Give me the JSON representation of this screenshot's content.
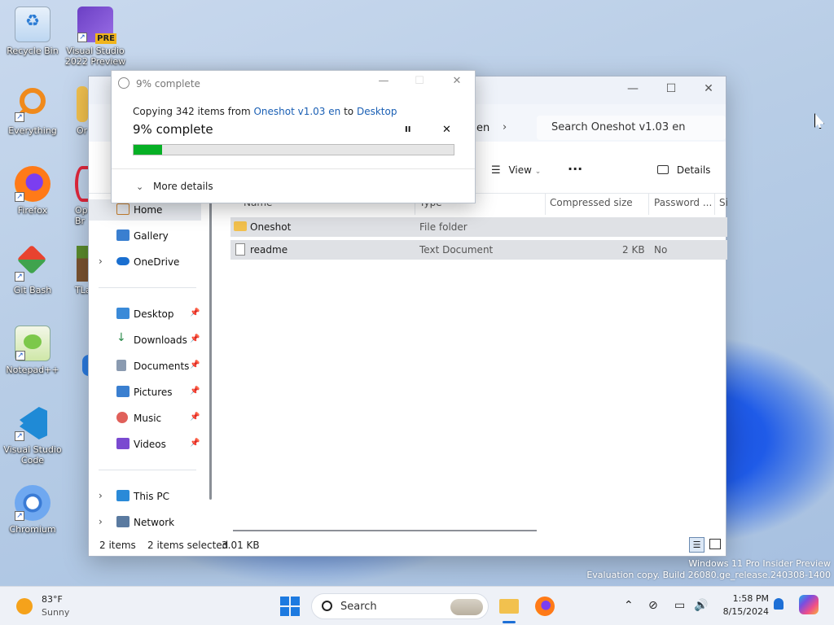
{
  "desktop": {
    "icons": [
      {
        "label": "Recycle Bin"
      },
      {
        "label": "Visual Studio 2022 Preview",
        "badge": "PRE"
      },
      {
        "label": "Everything"
      },
      {
        "label": "Or"
      },
      {
        "label": "Firefox"
      },
      {
        "label": "Op Br"
      },
      {
        "label": "Git Bash"
      },
      {
        "label": "TLa"
      },
      {
        "label": "Notepad++"
      },
      {
        "label": "Visual Studio Code"
      },
      {
        "label": "Chromium"
      }
    ],
    "watermark_line1": "Windows 11 Pro Insider Preview",
    "watermark_line2": "Evaluation copy. Build 26080.ge_release.240308-1400"
  },
  "explorer": {
    "address_crumb": "en",
    "search_placeholder": "Search Oneshot v1.03 en",
    "toolbar": {
      "view_label": "View",
      "more_label": "···",
      "details_label": "Details"
    },
    "sidebar": {
      "items": [
        {
          "label": "Home",
          "selected": true
        },
        {
          "label": "Gallery"
        },
        {
          "label": "OneDrive",
          "expandable": true
        },
        {
          "label": "Desktop",
          "pinned": true
        },
        {
          "label": "Downloads",
          "pinned": true
        },
        {
          "label": "Documents",
          "pinned": true
        },
        {
          "label": "Pictures",
          "pinned": true
        },
        {
          "label": "Music",
          "pinned": true
        },
        {
          "label": "Videos",
          "pinned": true
        },
        {
          "label": "This PC",
          "expandable": true
        },
        {
          "label": "Network",
          "expandable": true
        }
      ]
    },
    "columns": [
      "Name",
      "Type",
      "Compressed size",
      "Password ...",
      "Si"
    ],
    "rows": [
      {
        "name": "Oneshot",
        "type": "File folder",
        "compressed_size": "",
        "password": ""
      },
      {
        "name": "readme",
        "type": "Text Document",
        "compressed_size": "2 KB",
        "password": "No"
      }
    ],
    "status": {
      "items_count": "2 items",
      "selected": "2 items selected",
      "size": "3.01 KB"
    }
  },
  "copy_dialog": {
    "title": "9% complete",
    "copying_prefix": "Copying 342 items from",
    "source": "Oneshot v1.03 en",
    "to_word": "to",
    "destination": "Desktop",
    "percent_text": "9% complete",
    "progress_fraction": 0.09,
    "pause_symbol": "II",
    "cancel_symbol": "✕",
    "more_details": "More details"
  },
  "taskbar": {
    "weather_temp": "83°F",
    "weather_desc": "Sunny",
    "search_label": "Search",
    "time": "1:58 PM",
    "date": "8/15/2024"
  },
  "colors": {
    "accent": "#1a5fb4",
    "progress": "#06b025",
    "selection": "#dfe1e5"
  }
}
